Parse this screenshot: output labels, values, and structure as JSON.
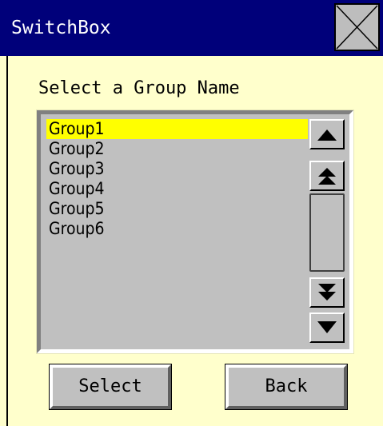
{
  "window": {
    "title": "SwitchBox",
    "close_icon": "close-x-icon"
  },
  "dialog": {
    "heading": "Select a Group Name",
    "group_list": {
      "items": [
        {
          "label": "Group1",
          "selected": true
        },
        {
          "label": "Group2",
          "selected": false
        },
        {
          "label": "Group3",
          "selected": false
        },
        {
          "label": "Group4",
          "selected": false
        },
        {
          "label": "Group5",
          "selected": false
        },
        {
          "label": "Group6",
          "selected": false
        }
      ],
      "scroll_icons": [
        "scroll-up-icon",
        "page-up-icon",
        "page-down-icon",
        "scroll-down-icon"
      ]
    },
    "buttons": {
      "select_label": "Select",
      "back_label": "Back"
    }
  },
  "colors": {
    "titlebar": "#00007a",
    "panel_background": "#ffffcc",
    "list_background": "#c0c0c0",
    "selection": "#ffff00"
  }
}
